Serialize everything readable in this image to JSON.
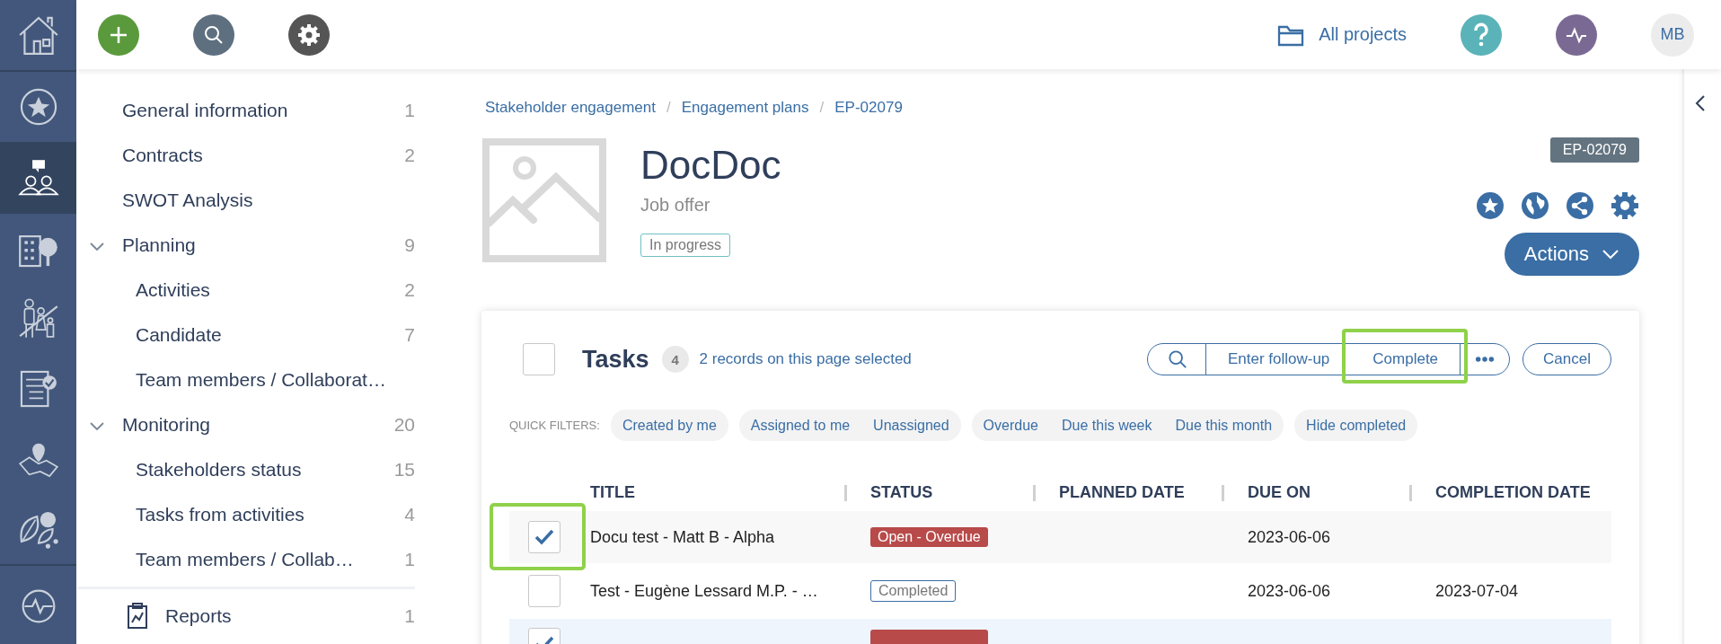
{
  "rail": {
    "groups": [
      [
        {
          "kind": "home",
          "selected": false
        }
      ],
      [
        {
          "kind": "star",
          "selected": false
        }
      ],
      [
        {
          "kind": "stakeholders",
          "selected": true
        },
        {
          "kind": "building",
          "selected": false
        },
        {
          "kind": "family",
          "selected": false
        },
        {
          "kind": "checklist",
          "selected": false
        },
        {
          "kind": "map",
          "selected": false
        },
        {
          "kind": "leaves",
          "selected": false
        }
      ],
      [
        {
          "kind": "pulse",
          "selected": false
        }
      ]
    ]
  },
  "topbar": {
    "buttons": [
      {
        "kind": "add"
      },
      {
        "kind": "search"
      },
      {
        "kind": "settings"
      }
    ],
    "project_link": "All projects",
    "right_buttons": [
      {
        "kind": "help"
      },
      {
        "kind": "pulse"
      }
    ],
    "avatar": "MB"
  },
  "sidebar": {
    "items": [
      {
        "label": "General information",
        "count": "1"
      },
      {
        "label": "Contracts",
        "count": "2"
      },
      {
        "label": "SWOT Analysis"
      },
      {
        "label": "Planning",
        "count": "9",
        "expanded": true,
        "children": [
          {
            "label": "Activities",
            "count": "2"
          },
          {
            "label": "Candidate",
            "count": "7"
          },
          {
            "label": "Team members / Collaborat…"
          }
        ]
      },
      {
        "label": "Monitoring",
        "count": "20",
        "expanded": true,
        "children": [
          {
            "label": "Stakeholders status",
            "count": "15"
          },
          {
            "label": "Tasks from activities",
            "count": "4"
          },
          {
            "label": "Team members / Collab…",
            "count": "1"
          }
        ]
      }
    ],
    "footer_items": [
      {
        "label": "Reports",
        "count": "1"
      }
    ]
  },
  "breadcrumb": [
    {
      "label": "Stakeholder engagement"
    },
    {
      "separator": "/",
      "label": "Engagement plans"
    },
    {
      "separator": "/",
      "label": "EP-02079"
    }
  ],
  "record": {
    "title": "DocDoc",
    "subtitle": "Job offer",
    "status": "In progress",
    "code": "EP-02079",
    "icons": [
      {
        "kind": "star"
      },
      {
        "kind": "globe"
      },
      {
        "kind": "share"
      },
      {
        "kind": "settings"
      }
    ],
    "actions_label": "Actions"
  },
  "tasks": {
    "title": "Tasks",
    "count": "4",
    "selection_note": "2 records on this page selected",
    "all_selected": false,
    "toolbar": [
      {
        "kind": "search",
        "highlighted": false
      },
      {
        "kind": "text",
        "label": "Enter follow-up",
        "highlighted": false
      },
      {
        "kind": "text",
        "label": "Complete",
        "highlighted": true
      },
      {
        "kind": "more",
        "highlighted": false
      }
    ],
    "cancel_label": "Cancel",
    "quick_filters_label": "QUICK FILTERS:",
    "quick_filter_groups": [
      [
        "Created by me"
      ],
      [
        "Assigned to me",
        "Unassigned"
      ],
      [
        "Overdue",
        "Due this week",
        "Due this month"
      ],
      [
        "Hide completed"
      ]
    ],
    "columns": [
      "TITLE",
      "STATUS",
      "PLANNED DATE",
      "DUE ON",
      "COMPLETION DATE"
    ],
    "rows": [
      {
        "title": "Docu test - Matt B - Alpha",
        "status": {
          "label": "Open - Overdue",
          "kind": "overdue"
        },
        "due_on": "2023-06-06",
        "selected": true,
        "highlighted": true
      },
      {
        "title": "Test - Eugène Lessard M.P. - …",
        "status": {
          "label": "Completed",
          "kind": "completed"
        },
        "due_on": "2023-06-06",
        "completion_date": "2023-07-04",
        "selected": false,
        "highlighted": false
      },
      {
        "status": {
          "kind": "overdue"
        },
        "selected": true,
        "highlighted": false
      }
    ]
  }
}
